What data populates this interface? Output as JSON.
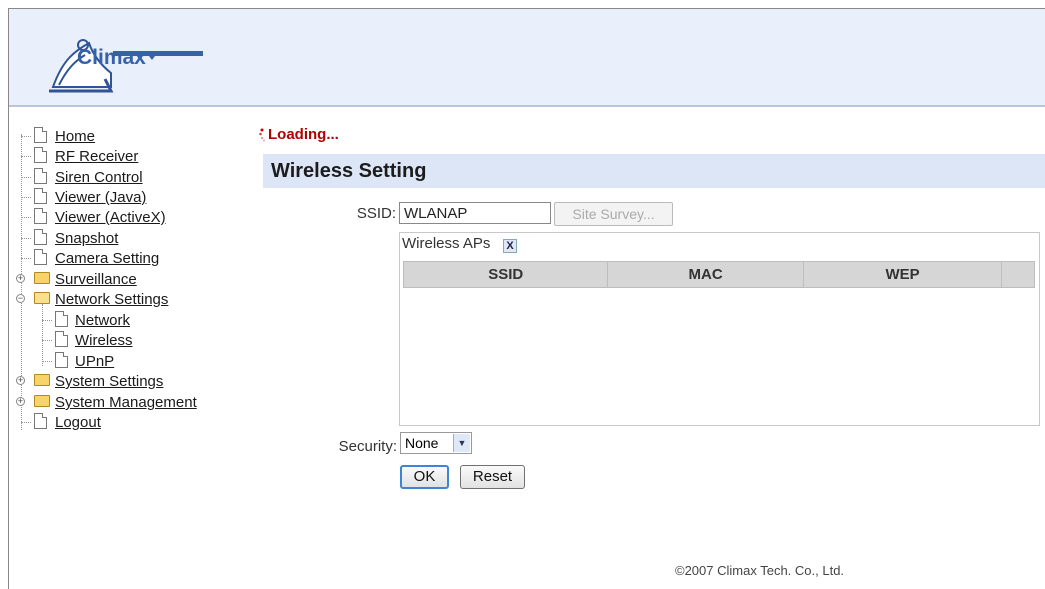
{
  "brand": {
    "name": "Climax",
    "accent": "#3562a9"
  },
  "nav": {
    "home": "Home",
    "rf_receiver": "RF Receiver",
    "siren_control": "Siren Control",
    "viewer_java": "Viewer (Java)",
    "viewer_activex": "Viewer (ActiveX)",
    "snapshot": "Snapshot",
    "camera_setting": "Camera Setting",
    "surveillance": "Surveillance",
    "network_settings": "Network Settings",
    "network": "Network",
    "wireless": "Wireless",
    "upnp": "UPnP",
    "system_settings": "System Settings",
    "system_management": "System Management",
    "logout": "Logout"
  },
  "status": {
    "loading": "Loading..."
  },
  "page": {
    "title": "Wireless Setting"
  },
  "form": {
    "ssid_label": "SSID:",
    "ssid_value": "WLANAP",
    "site_survey": "Site Survey...",
    "aps_label": "Wireless APs",
    "aps_close": "X",
    "aps_columns": [
      "SSID",
      "MAC",
      "WEP"
    ],
    "security_label": "Security:",
    "security_value": "None",
    "ok": "OK",
    "reset": "Reset"
  },
  "footer": {
    "copyright": "©2007 Climax Tech. Co., Ltd."
  }
}
